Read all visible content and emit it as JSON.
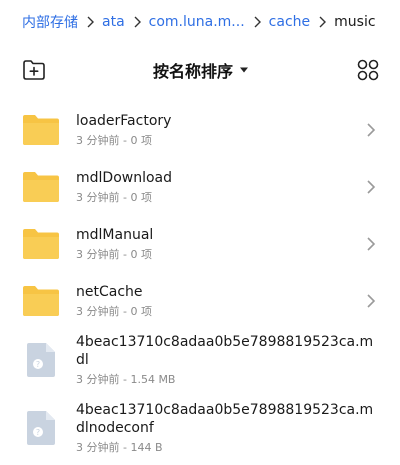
{
  "breadcrumb": {
    "items": [
      "内部存储",
      "ata",
      "com.luna.m...",
      "cache",
      "music"
    ]
  },
  "toolbar": {
    "sort_label": "按名称排序",
    "new_folder_icon": "add-folder-icon",
    "view_icon": "grid-view-icon"
  },
  "list": [
    {
      "name": "loaderFactory",
      "meta": "3 分钟前 - 0 项",
      "type": "folder"
    },
    {
      "name": "mdlDownload",
      "meta": "3 分钟前 - 0 项",
      "type": "folder"
    },
    {
      "name": "mdlManual",
      "meta": "3 分钟前 - 0 项",
      "type": "folder"
    },
    {
      "name": "netCache",
      "meta": "3 分钟前 - 0 项",
      "type": "folder"
    },
    {
      "name": "4beac13710c8adaa0b5e7898819523ca.mdl",
      "meta": "3 分钟前 - 1.54 MB",
      "type": "file"
    },
    {
      "name": "4beac13710c8adaa0b5e7898819523ca.mdlnodeconf",
      "meta": "3 分钟前 - 144 B",
      "type": "file"
    }
  ],
  "colors": {
    "accent": "#2f6fe4",
    "folder": "#f7c444",
    "file": "#c9d3e0"
  }
}
